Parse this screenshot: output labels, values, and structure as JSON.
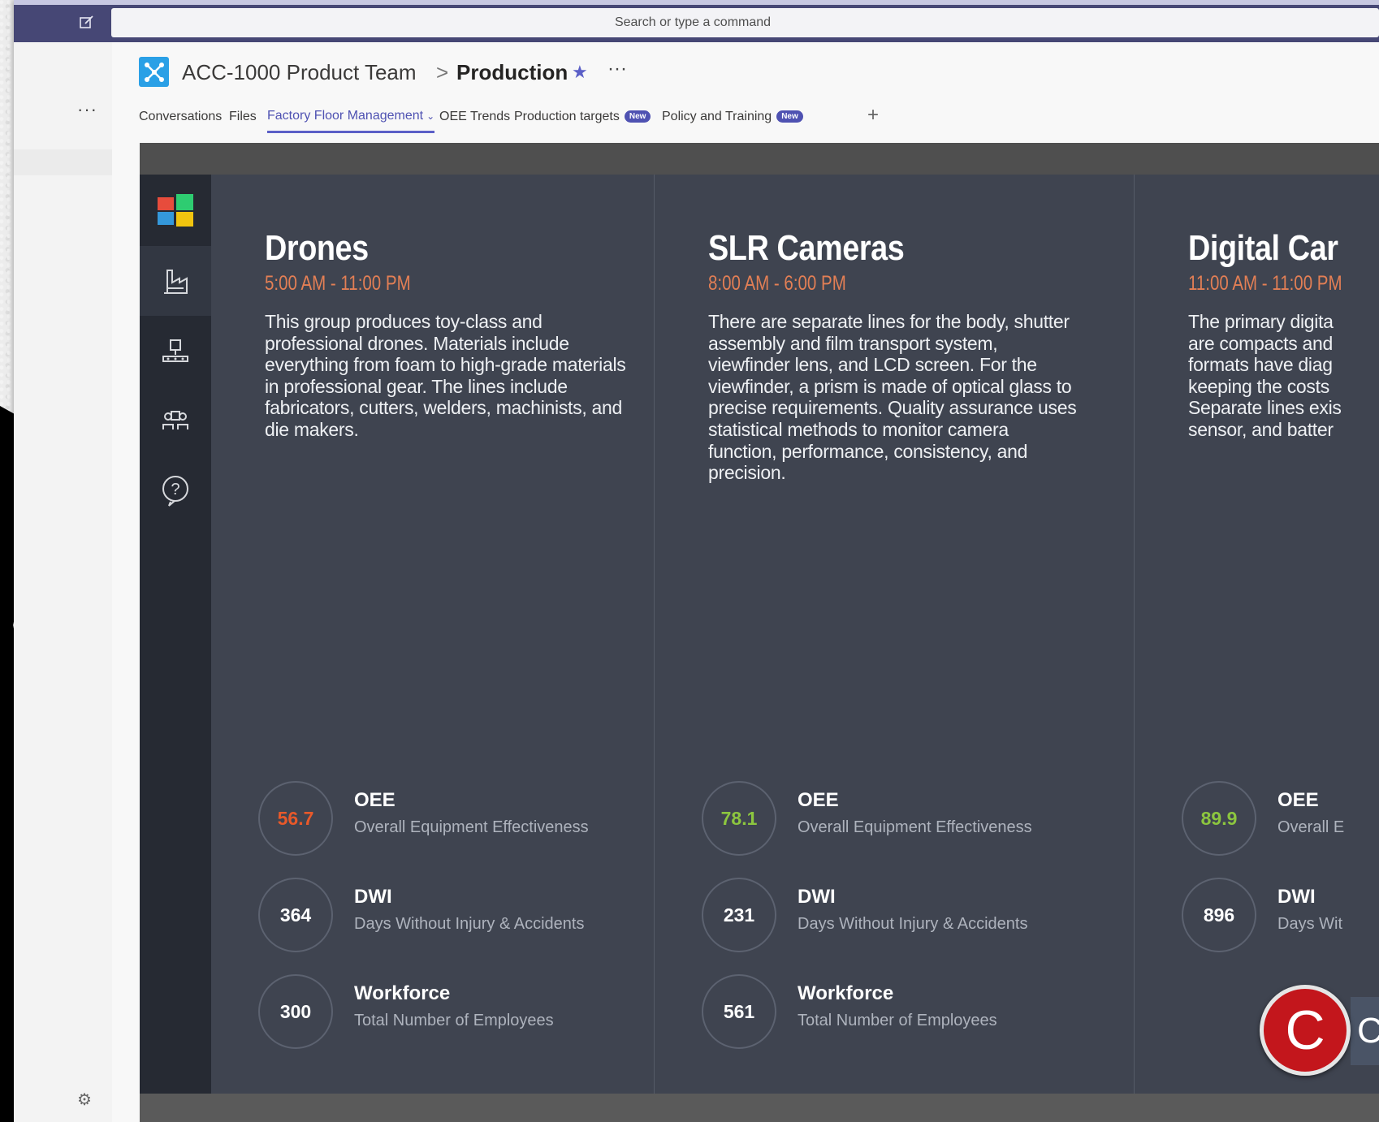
{
  "search": {
    "placeholder": "Search or type a command"
  },
  "rail": {
    "more_label": "···",
    "gear_label": "⚙"
  },
  "header": {
    "team": "ACC-1000 Product Team",
    "separator": ">",
    "channel": "Production",
    "star": "★",
    "more": "···"
  },
  "tabs": [
    {
      "label": "Conversations",
      "active": false,
      "badge": ""
    },
    {
      "label": "Files",
      "active": false,
      "badge": ""
    },
    {
      "label": "Factory Floor Management",
      "active": true,
      "badge": ""
    },
    {
      "label": "OEE Trends",
      "active": false,
      "badge": ""
    },
    {
      "label": "Production targets",
      "active": false,
      "badge": "New"
    },
    {
      "label": "Policy and Training",
      "active": false,
      "badge": "New"
    }
  ],
  "tab_add": "+",
  "colors": {
    "accent": "#5b5fc7",
    "titlebar": "#464775",
    "hours": "#e37f55",
    "oee_bad": "#e8592a",
    "oee_good": "#8cc63f"
  },
  "panels": [
    {
      "title": "Drones",
      "hours": "5:00 AM - 11:00 PM",
      "description": "This group produces toy-class and professional drones. Materials include everything from foam to high-grade materials in professional gear. The lines include fabricators, cutters, welders, machinists, and die makers.",
      "metrics": [
        {
          "value": "56.7",
          "name": "OEE",
          "desc": "Overall Equipment Effectiveness",
          "color": "#e8592a"
        },
        {
          "value": "364",
          "name": "DWI",
          "desc": "Days Without Injury & Accidents",
          "color": "#ffffff"
        },
        {
          "value": "300",
          "name": "Workforce",
          "desc": "Total Number of Employees",
          "color": "#ffffff"
        }
      ]
    },
    {
      "title": "SLR Cameras",
      "hours": "8:00 AM - 6:00 PM",
      "description": "There are separate lines for the body, shutter assembly and film transport system, viewfinder lens, and LCD screen. For the viewfinder, a prism is made of optical glass to precise requirements. Quality assurance uses statistical methods to monitor camera function, performance, consistency, and precision.",
      "metrics": [
        {
          "value": "78.1",
          "name": "OEE",
          "desc": "Overall Equipment Effectiveness",
          "color": "#8cc63f"
        },
        {
          "value": "231",
          "name": "DWI",
          "desc": "Days Without Injury & Accidents",
          "color": "#ffffff"
        },
        {
          "value": "561",
          "name": "Workforce",
          "desc": "Total Number of Employees",
          "color": "#ffffff"
        }
      ]
    },
    {
      "title": "Digital Car",
      "hours": "11:00 AM - 11:00 PM",
      "description": "The primary digita are compacts and formats have diag keeping the costs Separate lines exis sensor, and batter",
      "metrics": [
        {
          "value": "89.9",
          "name": "OEE",
          "desc": "Overall E",
          "color": "#8cc63f"
        },
        {
          "value": "896",
          "name": "DWI",
          "desc": "Days Wit",
          "color": "#ffffff"
        }
      ]
    }
  ],
  "nav_icons": [
    "factory-icon",
    "production-line-icon",
    "workforce-icon",
    "help-icon"
  ],
  "badge": {
    "letter": "C",
    "tail": "C"
  }
}
